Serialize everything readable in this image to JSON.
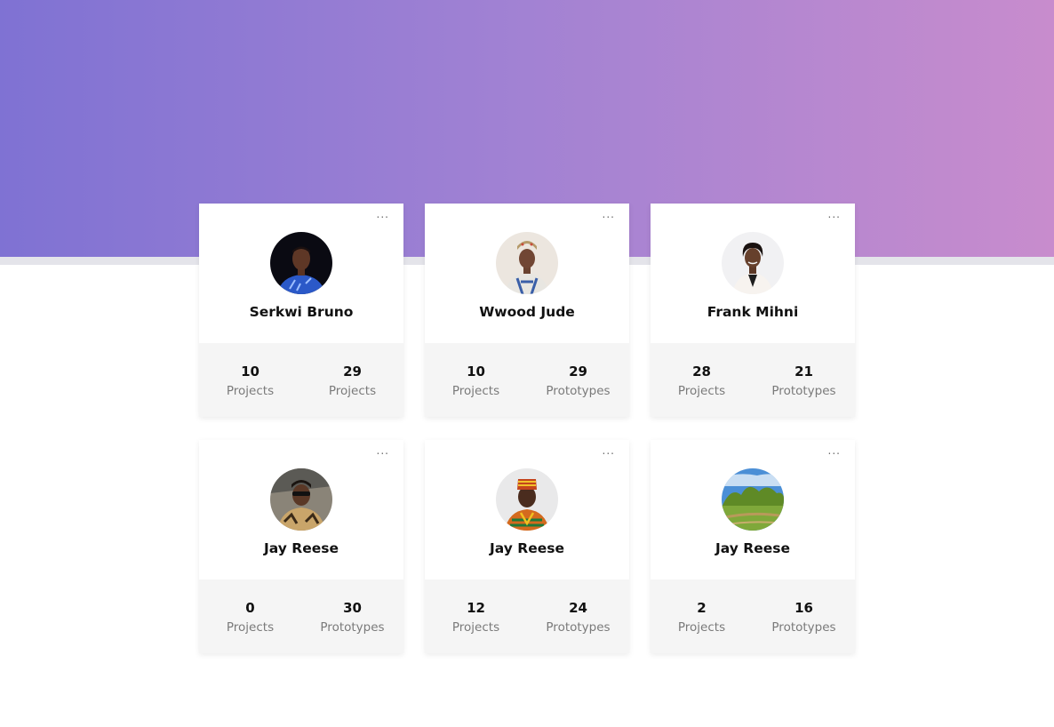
{
  "colors": {
    "hero_gradient_start": "#7f72d3",
    "hero_gradient_end": "#c88ccd",
    "stats_background": "#f5f5f5"
  },
  "cards": [
    {
      "menu": "...",
      "name": "Serkwi Bruno",
      "avatar": "avatar-portrait-blue-shirt",
      "stats": [
        {
          "value": "10",
          "label": "Projects"
        },
        {
          "value": "29",
          "label": "Projects"
        }
      ]
    },
    {
      "menu": "...",
      "name": "Wwood Jude",
      "avatar": "avatar-portrait-traditional-attire",
      "stats": [
        {
          "value": "10",
          "label": "Projects"
        },
        {
          "value": "29",
          "label": "Prototypes"
        }
      ]
    },
    {
      "menu": "...",
      "name": "Frank Mihni",
      "avatar": "avatar-portrait-white-blazer",
      "stats": [
        {
          "value": "28",
          "label": "Projects"
        },
        {
          "value": "21",
          "label": "Prototypes"
        }
      ]
    },
    {
      "menu": "...",
      "name": "Jay Reese",
      "avatar": "avatar-portrait-sunglasses",
      "stats": [
        {
          "value": "0",
          "label": "Projects"
        },
        {
          "value": "30",
          "label": "Prototypes"
        }
      ]
    },
    {
      "menu": "...",
      "name": "Jay Reese",
      "avatar": "avatar-portrait-kente-hat",
      "stats": [
        {
          "value": "12",
          "label": "Projects"
        },
        {
          "value": "24",
          "label": "Prototypes"
        }
      ]
    },
    {
      "menu": "...",
      "name": "Jay Reese",
      "avatar": "avatar-landscape-meadow",
      "stats": [
        {
          "value": "2",
          "label": "Projects"
        },
        {
          "value": "16",
          "label": "Prototypes"
        }
      ]
    }
  ]
}
